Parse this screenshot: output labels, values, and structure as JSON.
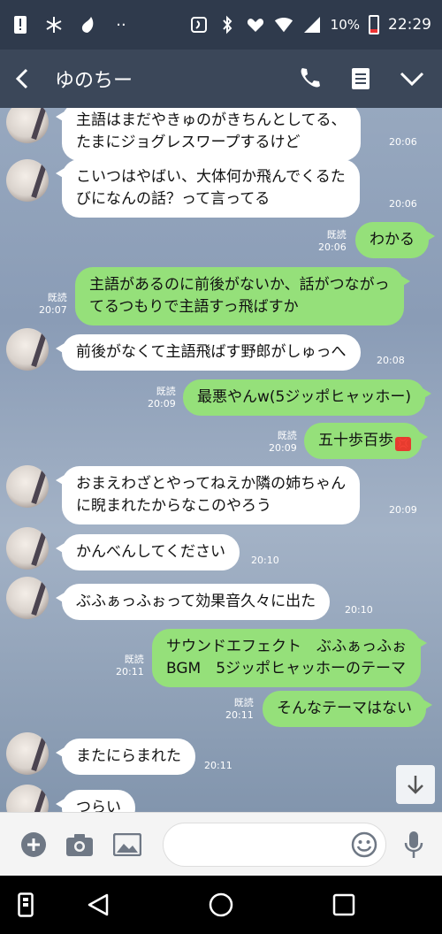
{
  "status_bar": {
    "battery": "10%",
    "time": "22:29",
    "left_icons": [
      "alert-icon",
      "pinwheel-icon",
      "drop-icon",
      "more-dots-icon"
    ],
    "right_icons": [
      "nfc-icon",
      "bluetooth-icon",
      "heart-settings-icon",
      "wifi-icon",
      "signal-icon",
      "battery-icon"
    ]
  },
  "header": {
    "title": "ゆのちー"
  },
  "messages": [
    {
      "dir": "in",
      "lines": "主語はまだやきゅのがきちんとしてる、\nたまにジョグレスワープするけど",
      "time": "20:06"
    },
    {
      "dir": "in",
      "lines": "こいつはやばい、大体何か飛んでくるた\nびになんの話？って言ってる",
      "time": "20:06"
    },
    {
      "dir": "out",
      "lines": "わかる",
      "read": "既読",
      "time": "20:06"
    },
    {
      "dir": "out",
      "lines": "主語があるのに前後がないか、話がつながっ\nてるつもりで主語すっ飛ばすか",
      "read": "既読",
      "time": "20:07"
    },
    {
      "dir": "in",
      "lines": "前後がなくて主語飛ばす野郎がしゅっへ",
      "time": "20:08"
    },
    {
      "dir": "out",
      "lines": "最悪やんw(5ジッポヒャッホー)",
      "read": "既読",
      "time": "20:09"
    },
    {
      "dir": "out",
      "lines": "五十歩百歩",
      "emoji": "💢",
      "read": "既読",
      "time": "20:09"
    },
    {
      "dir": "in",
      "lines": "おまえわざとやってねえか隣の姉ちゃん\nに睨まれたからなこのやろう",
      "time": "20:09"
    },
    {
      "dir": "in",
      "lines": "かんべんしてください",
      "time": "20:10"
    },
    {
      "dir": "in",
      "lines": "ぶふぁっふぉって効果音久々に出た",
      "time": "20:10"
    },
    {
      "dir": "out",
      "lines": "サウンドエフェクト　ぶふぁっふぉ\nBGM　5ジッポヒャッホーのテーマ",
      "read": "既読",
      "time": "20:11"
    },
    {
      "dir": "out",
      "lines": "そんなテーマはない",
      "read": "既読",
      "time": "20:11"
    },
    {
      "dir": "in",
      "lines": "またにらまれた",
      "time": "20:11"
    },
    {
      "dir": "in",
      "lines": "つらい",
      "time": ""
    }
  ],
  "input": {
    "placeholder": "",
    "value": ""
  },
  "colors": {
    "header": "#3b4759",
    "status_bar": "#2f3a4c",
    "outgoing_bubble": "#95e07a",
    "incoming_bubble": "#ffffff"
  }
}
